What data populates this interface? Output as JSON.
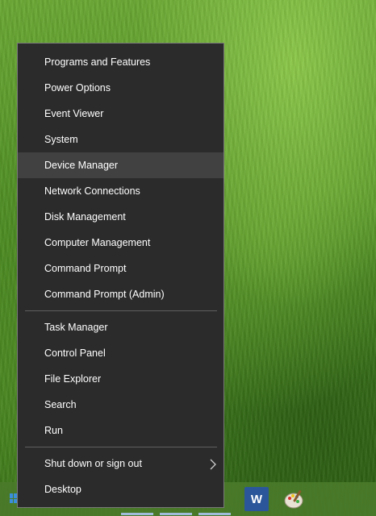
{
  "menu": {
    "group1": [
      {
        "label": "Programs and Features"
      },
      {
        "label": "Power Options"
      },
      {
        "label": "Event Viewer"
      },
      {
        "label": "System"
      },
      {
        "label": "Device Manager",
        "highlighted": true
      },
      {
        "label": "Network Connections"
      },
      {
        "label": "Disk Management"
      },
      {
        "label": "Computer Management"
      },
      {
        "label": "Command Prompt"
      },
      {
        "label": "Command Prompt (Admin)"
      }
    ],
    "group2": [
      {
        "label": "Task Manager"
      },
      {
        "label": "Control Panel"
      },
      {
        "label": "File Explorer"
      },
      {
        "label": "Search"
      },
      {
        "label": "Run"
      }
    ],
    "group3": [
      {
        "label": "Shut down or sign out",
        "submenu_icon": "chevron-right-icon"
      },
      {
        "label": "Desktop"
      }
    ]
  },
  "taskbar": {
    "word_icon_letter": "W",
    "icons": [
      "windows-start-icon",
      "word-icon",
      "paint-icon"
    ]
  },
  "colors": {
    "menu_background": "#2b2b2b",
    "menu_highlight": "#414141",
    "menu_text": "#ffffff",
    "wallpaper_green": "#4f8f24"
  }
}
